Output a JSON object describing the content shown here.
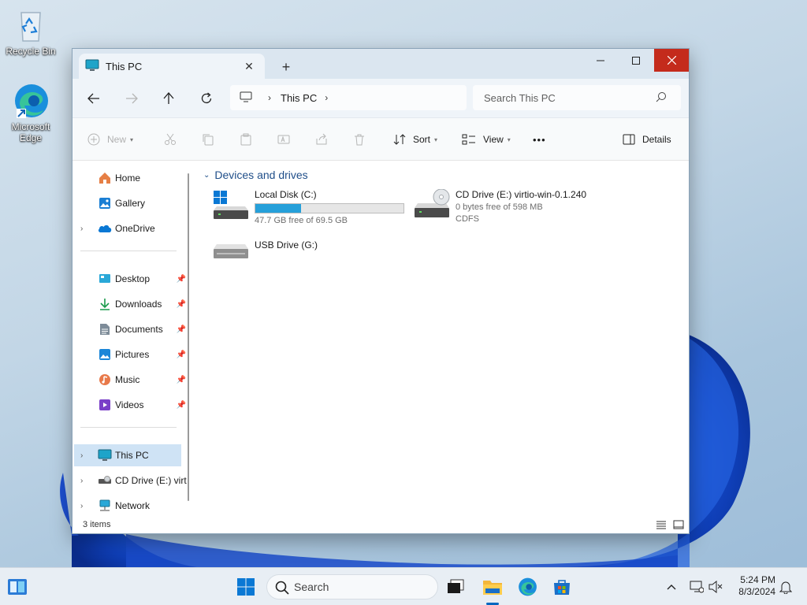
{
  "desktop": {
    "icons": [
      {
        "label": "Recycle Bin"
      },
      {
        "label": "Microsoft Edge"
      }
    ]
  },
  "window": {
    "tab_title": "This PC",
    "address": {
      "crumb": "This PC"
    },
    "search_placeholder": "Search This PC",
    "toolbar": {
      "new_label": "New",
      "sort_label": "Sort",
      "view_label": "View",
      "more_label": "•••",
      "details_label": "Details"
    },
    "sidebar": {
      "items": [
        {
          "label": "Home"
        },
        {
          "label": "Gallery"
        },
        {
          "label": "OneDrive"
        },
        {
          "label": "Desktop"
        },
        {
          "label": "Downloads"
        },
        {
          "label": "Documents"
        },
        {
          "label": "Pictures"
        },
        {
          "label": "Music"
        },
        {
          "label": "Videos"
        },
        {
          "label": "This PC"
        },
        {
          "label": "CD Drive (E:) virt"
        },
        {
          "label": "Network"
        }
      ]
    },
    "content": {
      "group_title": "Devices and drives",
      "drives": [
        {
          "name": "Local Disk (C:)",
          "free_text": "47.7 GB free of 69.5 GB",
          "used_fraction": 0.31
        },
        {
          "name": "CD Drive (E:) virtio-win-0.1.240",
          "free_text": "0 bytes free of 598 MB",
          "fs_text": "CDFS"
        },
        {
          "name": "USB Drive (G:)"
        }
      ]
    },
    "status": {
      "items_text": "3 items"
    }
  },
  "taskbar": {
    "search_placeholder": "Search",
    "time": "5:24 PM",
    "date": "8/3/2024"
  },
  "colors": {
    "accent": "#0067c0",
    "close_red": "#c42b1c",
    "progress": "#26a0da",
    "group_heading": "#1f4e89"
  }
}
